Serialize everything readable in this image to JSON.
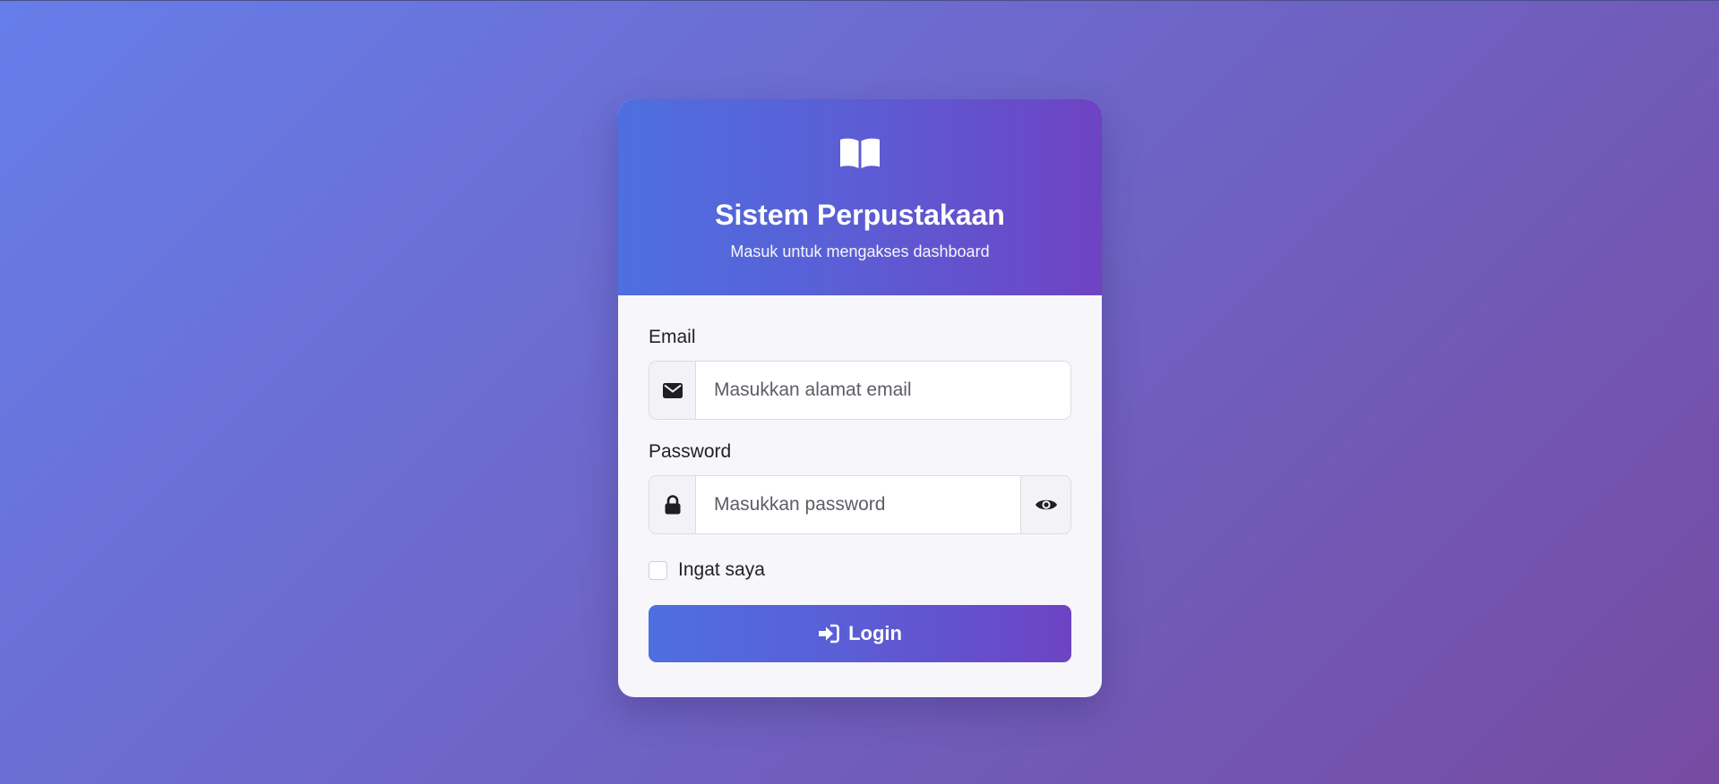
{
  "header": {
    "icon": "book-open-icon",
    "title": "Sistem Perpustakaan",
    "subtitle": "Masuk untuk mengakses dashboard"
  },
  "form": {
    "email": {
      "label": "Email",
      "icon": "envelope-icon",
      "placeholder": "Masukkan alamat email",
      "value": ""
    },
    "password": {
      "label": "Password",
      "icon": "lock-icon",
      "placeholder": "Masukkan password",
      "value": "",
      "toggle_icon": "eye-icon"
    },
    "remember": {
      "label": "Ingat saya",
      "checked": false
    },
    "submit": {
      "icon": "sign-in-icon",
      "label": "Login"
    }
  },
  "colors": {
    "background_start": "#667eea",
    "background_end": "#764ba2",
    "header_start": "#4e6fe0",
    "header_end": "#6e43c3"
  }
}
